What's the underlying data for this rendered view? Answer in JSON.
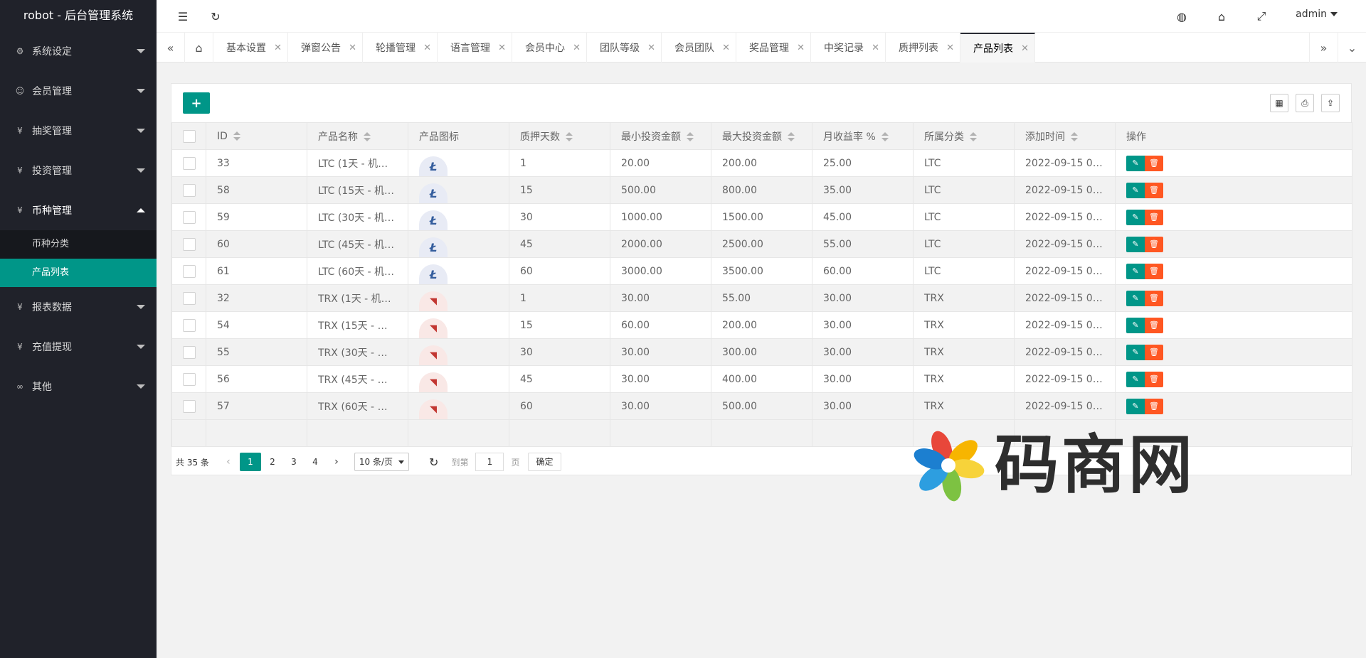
{
  "app": {
    "title": "robot - 后台管理系统"
  },
  "sidebar": {
    "items": [
      {
        "label": "系统设定",
        "icon": "gear-icon"
      },
      {
        "label": "会员管理",
        "icon": "user-icon"
      },
      {
        "label": "抽奖管理",
        "icon": "yen-icon"
      },
      {
        "label": "投资管理",
        "icon": "yen-icon"
      },
      {
        "label": "币种管理",
        "icon": "yen-icon",
        "open": true
      },
      {
        "label": "报表数据",
        "icon": "yen-icon"
      },
      {
        "label": "充值提现",
        "icon": "yen-icon"
      },
      {
        "label": "其他",
        "icon": "link-icon"
      }
    ],
    "subitems": [
      {
        "label": "币种分类"
      },
      {
        "label": "产品列表",
        "active": true
      }
    ]
  },
  "header": {
    "user": "admin"
  },
  "tabs": [
    "基本设置",
    "弹窗公告",
    "轮播管理",
    "语言管理",
    "会员中心",
    "团队等级",
    "会员团队",
    "奖品管理",
    "中奖记录",
    "质押列表",
    "产品列表"
  ],
  "table": {
    "columns": [
      "ID",
      "产品名称",
      "产品图标",
      "质押天数",
      "最小投资金额",
      "最大投资金额",
      "月收益率 %",
      "所属分类",
      "添加时间",
      "操作"
    ],
    "rows": [
      {
        "id": "33",
        "name": "LTC (1天 - 机器…",
        "coin": "LTC",
        "days": "1",
        "min": "20.00",
        "max": "200.00",
        "rate": "25.00",
        "cat": "LTC",
        "time": "2022-09-15 01:…"
      },
      {
        "id": "58",
        "name": "LTC (15天 - 机…",
        "coin": "LTC",
        "days": "15",
        "min": "500.00",
        "max": "800.00",
        "rate": "35.00",
        "cat": "LTC",
        "time": "2022-09-15 01:…"
      },
      {
        "id": "59",
        "name": "LTC (30天 - 机…",
        "coin": "LTC",
        "days": "30",
        "min": "1000.00",
        "max": "1500.00",
        "rate": "45.00",
        "cat": "LTC",
        "time": "2022-09-15 01:…"
      },
      {
        "id": "60",
        "name": "LTC (45天 - 机…",
        "coin": "LTC",
        "days": "45",
        "min": "2000.00",
        "max": "2500.00",
        "rate": "55.00",
        "cat": "LTC",
        "time": "2022-09-15 01:…"
      },
      {
        "id": "61",
        "name": "LTC (60天 - 机…",
        "coin": "LTC",
        "days": "60",
        "min": "3000.00",
        "max": "3500.00",
        "rate": "60.00",
        "cat": "LTC",
        "time": "2022-09-15 01:…"
      },
      {
        "id": "32",
        "name": "TRX (1天 - 机…",
        "coin": "TRX",
        "days": "1",
        "min": "30.00",
        "max": "55.00",
        "rate": "30.00",
        "cat": "TRX",
        "time": "2022-09-15 01:…"
      },
      {
        "id": "54",
        "name": "TRX (15天 - 机…",
        "coin": "TRX",
        "days": "15",
        "min": "60.00",
        "max": "200.00",
        "rate": "30.00",
        "cat": "TRX",
        "time": "2022-09-15 01:…"
      },
      {
        "id": "55",
        "name": "TRX (30天 - 机…",
        "coin": "TRX",
        "days": "30",
        "min": "30.00",
        "max": "300.00",
        "rate": "30.00",
        "cat": "TRX",
        "time": "2022-09-15 01:…"
      },
      {
        "id": "56",
        "name": "TRX (45天 - 机…",
        "coin": "TRX",
        "days": "45",
        "min": "30.00",
        "max": "400.00",
        "rate": "30.00",
        "cat": "TRX",
        "time": "2022-09-15 01:…"
      },
      {
        "id": "57",
        "name": "TRX (60天 - 机…",
        "coin": "TRX",
        "days": "60",
        "min": "30.00",
        "max": "500.00",
        "rate": "30.00",
        "cat": "TRX",
        "time": "2022-09-15 01:…"
      }
    ]
  },
  "pager": {
    "total": "共 35 条",
    "pages": [
      "1",
      "2",
      "3",
      "4"
    ],
    "current": "1",
    "per_page": "10 条/页",
    "goto_label": "到第",
    "goto_value": "1",
    "page_unit": "页",
    "confirm": "确定"
  },
  "watermark": {
    "text": "码商网"
  },
  "colors": {
    "accent": "#009688",
    "danger": "#ff5722",
    "sidebar": "#20222a"
  }
}
